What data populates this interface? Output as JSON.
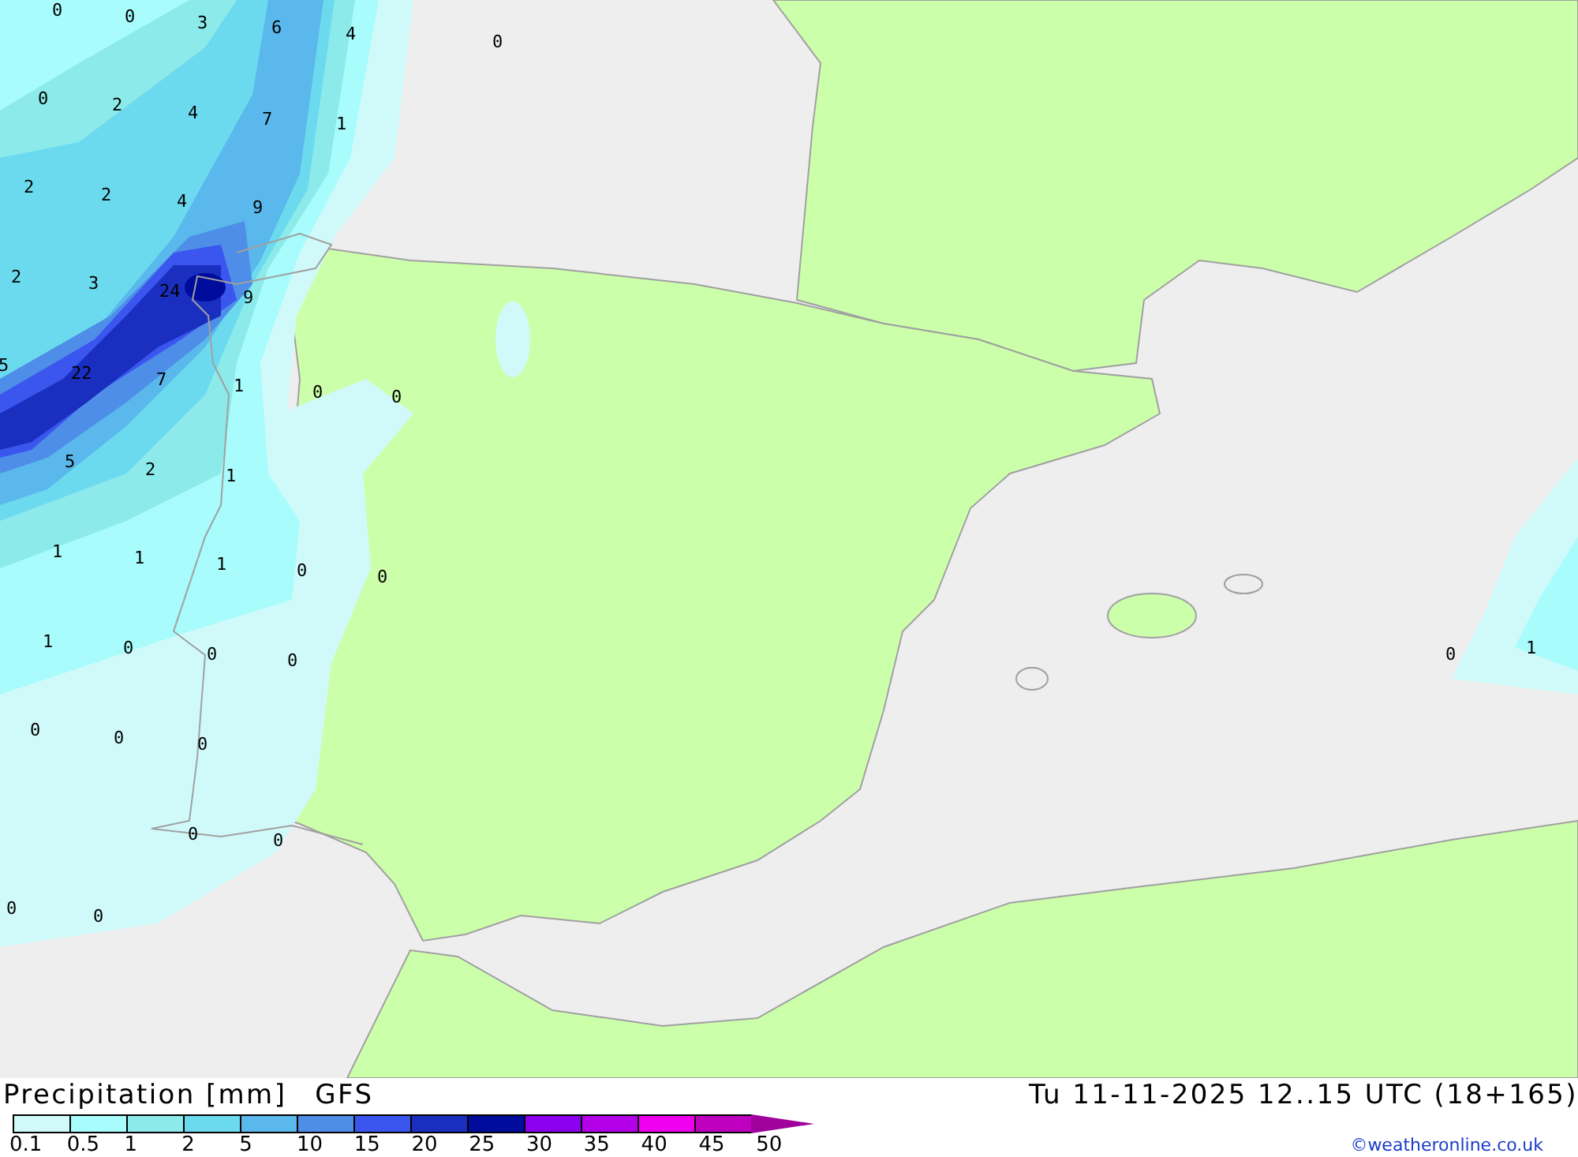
{
  "map": {
    "labels": [
      "0",
      "0",
      "3",
      "6",
      "4",
      "0",
      "0",
      "2",
      "4",
      "7",
      "1",
      "2",
      "2",
      "4",
      "9",
      "2",
      "3",
      "24",
      "9",
      "5",
      "22",
      "7",
      "1",
      "0",
      "0",
      "5",
      "2",
      "1",
      "1",
      "1",
      "1",
      "0",
      "0",
      "1",
      "0",
      "0",
      "0",
      "0",
      "0",
      "0",
      "0",
      "0",
      "0",
      "0",
      "0",
      "1"
    ]
  },
  "footer": {
    "title": "Precipitation [mm]",
    "model": "GFS",
    "valid_time": "Tu 11-11-2025 12..15 UTC (18+165)",
    "credit": "©weatheronline.co.uk",
    "legend": [
      {
        "label": "0.1",
        "color": "#d0fafa"
      },
      {
        "label": "0.5",
        "color": "#a8fcfc"
      },
      {
        "label": "1",
        "color": "#8ceaea"
      },
      {
        "label": "2",
        "color": "#6cdaee"
      },
      {
        "label": "5",
        "color": "#5ab8ec"
      },
      {
        "label": "10",
        "color": "#4f8ee8"
      },
      {
        "label": "15",
        "color": "#3a56ee"
      },
      {
        "label": "20",
        "color": "#1a2ec0"
      },
      {
        "label": "25",
        "color": "#000c9c"
      },
      {
        "label": "30",
        "color": "#8c00f0"
      },
      {
        "label": "35",
        "color": "#b400e8"
      },
      {
        "label": "40",
        "color": "#ee00ee"
      },
      {
        "label": "45",
        "color": "#c000c0"
      },
      {
        "label": "50",
        "color": "#a0009c"
      }
    ]
  }
}
